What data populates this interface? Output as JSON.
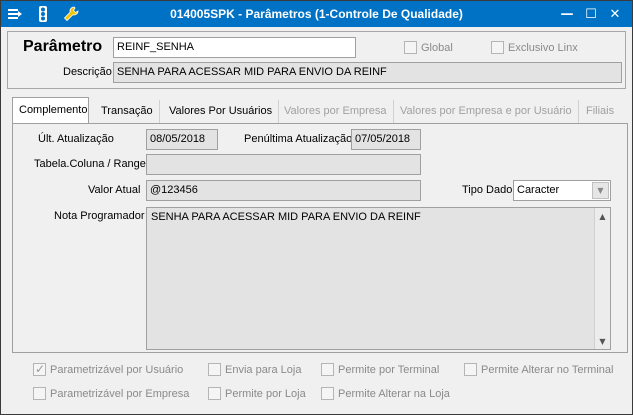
{
  "window": {
    "title": "014005SPK - Parâmetros (1-Controle De Qualidade)",
    "titlebar_color": "#0072c6",
    "controls": {
      "minimize": "—",
      "maximize": "☐",
      "close": "✕"
    },
    "icons": [
      "menu-icon",
      "traffic-light-icon",
      "wrench-icon"
    ]
  },
  "header": {
    "parametro_label": "Parâmetro",
    "parametro_value": "REINF_SENHA",
    "descricao_label": "Descrição",
    "descricao_value": "SENHA PARA ACESSAR MID PARA ENVIO DA REINF",
    "global_label": "Global",
    "global_checked": false,
    "exclusivo_label": "Exclusivo Linx",
    "exclusivo_checked": false
  },
  "tabs": [
    {
      "label": "Complemento",
      "active": true,
      "enabled": true
    },
    {
      "label": "Transação",
      "active": false,
      "enabled": true
    },
    {
      "label": "Valores Por Usuários",
      "active": false,
      "enabled": true
    },
    {
      "label": "Valores por Empresa",
      "active": false,
      "enabled": false
    },
    {
      "label": "Valores por Empresa e por Usuário",
      "active": false,
      "enabled": false
    },
    {
      "label": "Filiais",
      "active": false,
      "enabled": false
    }
  ],
  "complemento": {
    "ult_atualizacao_label": "Últ. Atualização",
    "ult_atualizacao_value": "08/05/2018",
    "penultima_label": "Penúltima Atualização",
    "penultima_value": "07/05/2018",
    "tabela_label": "Tabela.Coluna / Range",
    "tabela_value": "",
    "valor_atual_label": "Valor Atual",
    "valor_atual_value": "@123456",
    "tipo_dado_label": "Tipo Dado",
    "tipo_dado_value": "Caracter",
    "nota_label": "Nota Programador",
    "nota_value": "SENHA PARA ACESSAR MID PARA ENVIO DA REINF"
  },
  "options": {
    "parametrizavel_usuario": {
      "label": "Parametrizável por Usuário",
      "checked": true
    },
    "envia_loja": {
      "label": "Envia para Loja",
      "checked": false
    },
    "permite_terminal": {
      "label": "Permite por Terminal",
      "checked": false
    },
    "permite_alterar_terminal": {
      "label": "Permite Alterar no Terminal",
      "checked": false
    },
    "parametrizavel_empresa": {
      "label": "Parametrizável por Empresa",
      "checked": false
    },
    "permite_loja": {
      "label": "Permite por Loja",
      "checked": false
    },
    "permite_alterar_loja": {
      "label": "Permite Alterar na Loja",
      "checked": false
    }
  }
}
